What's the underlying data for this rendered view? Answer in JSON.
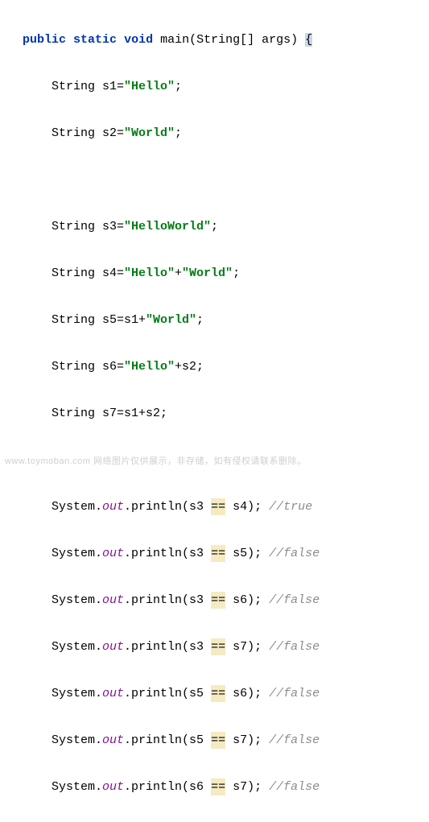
{
  "code": {
    "signature": {
      "kw_public": "public",
      "kw_static": "static",
      "kw_void": "void",
      "name": "main",
      "param": "(String[] args)",
      "brace": "{"
    },
    "decl": {
      "s1": {
        "var": "String s1=",
        "val": "\"Hello\"",
        "end": ";"
      },
      "s2": {
        "var": "String s2=",
        "val": "\"World\"",
        "end": ";"
      },
      "s3": {
        "var": "String s3=",
        "val": "\"HelloWorld\"",
        "end": ";"
      },
      "s4": {
        "var": "String s4=",
        "v1": "\"Hello\"",
        "plus": "+",
        "v2": "\"World\"",
        "end": ";"
      },
      "s5": {
        "var": "String s5=s1+",
        "val": "\"World\"",
        "end": ";"
      },
      "s6": {
        "var": "String s6=",
        "val": "\"Hello\"",
        "rest": "+s2;"
      },
      "s7": {
        "text": "String s7=s1+s2;"
      }
    },
    "out": {
      "prefix_sys": "System.",
      "field_out": "out",
      "mid": ".println(",
      "eq": "==",
      "l1": {
        "a": "s3 ",
        "b": " s4); ",
        "c": "//true"
      },
      "l2": {
        "a": "s3 ",
        "b": " s5); ",
        "c": "//false"
      },
      "l3": {
        "a": "s3 ",
        "b": " s6); ",
        "c": "//false"
      },
      "l4": {
        "a": "s3 ",
        "b": " s7); ",
        "c": "//false"
      },
      "l5": {
        "a": "s5 ",
        "b": " s6); ",
        "c": "//false"
      },
      "l6": {
        "a": "s5 ",
        "b": " s7); ",
        "c": "//false"
      },
      "l7": {
        "a": "s6 ",
        "b": " s7); ",
        "c": "//false"
      }
    }
  },
  "watermark": "www.toymoban.com   网络图片仅供展示，非存储，如有侵权请联系删除。"
}
